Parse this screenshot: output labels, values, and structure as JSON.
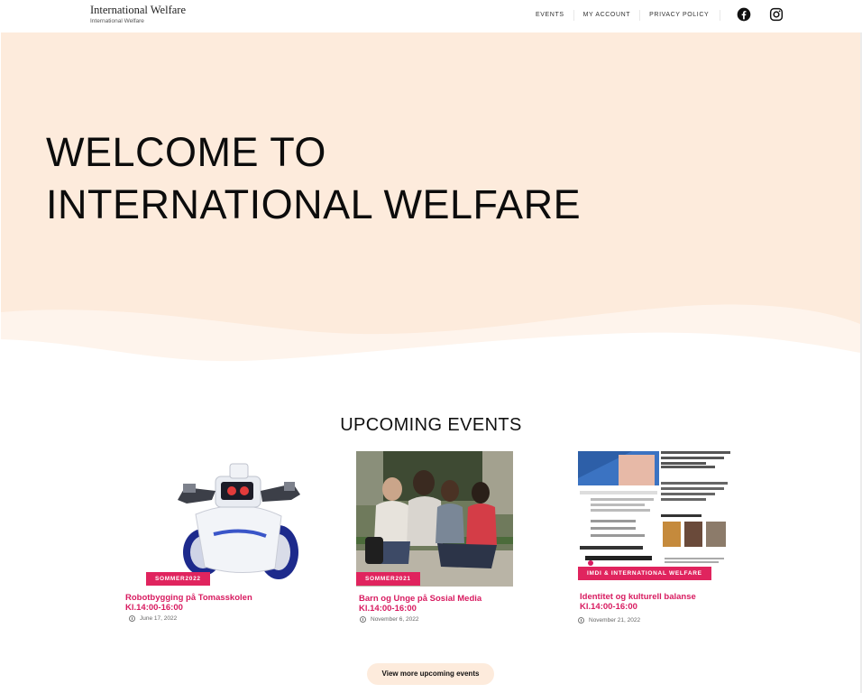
{
  "header": {
    "site_title": "International Welfare",
    "tagline": "International Welfare",
    "nav": [
      "EVENTS",
      "MY ACCOUNT",
      "PRIVACY POLICY"
    ],
    "social": [
      "facebook-icon",
      "instagram-icon"
    ]
  },
  "hero": {
    "title_line1": "WELCOME TO",
    "title_line2": "INTERNATIONAL WELFARE",
    "background": "#fdebdc"
  },
  "events": {
    "heading": "UPCOMING EVENTS",
    "items": [
      {
        "category": "SOMMER2022",
        "title_line1": "Robotbygging på Tomasskolen",
        "title_line2": "Kl.14:00-16:00",
        "date": "June 17, 2022",
        "image": "robot-toy-image"
      },
      {
        "category": "SOMMER2021",
        "title_line1": "Barn og Unge på Sosial Media",
        "title_line2": "Kl.14:00-16:00",
        "date": "November 6, 2022",
        "image": "youth-phones-photo"
      },
      {
        "category": "IMDI & INTERNATIONAL WELFARE",
        "title_line1": "Identitet og kulturell balanse",
        "title_line2": "Kl.14:00-16:00",
        "date": "November 21, 2022",
        "image": "event-flyer-image"
      }
    ],
    "more_button": "View more upcoming events"
  },
  "colors": {
    "accent": "#e0245e",
    "title_pink": "#d81b60",
    "hero_bg": "#fdebdc"
  }
}
